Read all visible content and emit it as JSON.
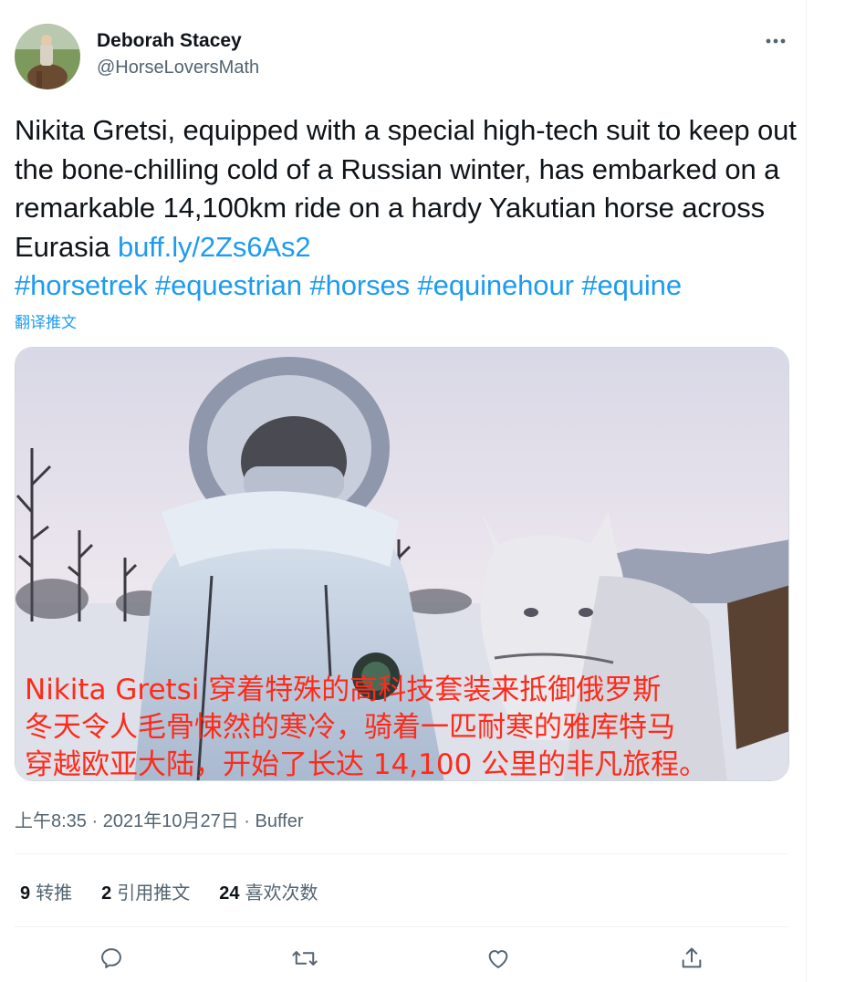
{
  "author": {
    "display_name": "Deborah Stacey",
    "handle": "@HorseLoversMath"
  },
  "tweet": {
    "text_main": "Nikita Gretsi, equipped with a special high-tech suit to keep out the bone-chilling cold of a Russian winter, has embarked on a remarkable 14,100km ride on a hardy Yakutian horse across Eurasia",
    "link": "buff.ly/2Zs6As2",
    "hashtags": [
      "#horsetrek",
      "#equestrian",
      "#horses",
      "#equinehour",
      "#equine"
    ],
    "translate_label": "翻译推文"
  },
  "media": {
    "caption_lines": [
      "Nikita Gretsi 穿着特殊的高科技套装来抵御俄罗斯",
      "冬天令人毛骨悚然的寒冷，骑着一匹耐寒的雅库特马",
      "穿越欧亚大陆，开始了长达 14,100 公里的非凡旅程。"
    ]
  },
  "meta": {
    "time": "上午8:35",
    "sep": "·",
    "date": "2021年10月27日",
    "source": "Buffer"
  },
  "stats": {
    "retweets_count": "9",
    "retweets_label": "转推",
    "quotes_count": "2",
    "quotes_label": "引用推文",
    "likes_count": "24",
    "likes_label": "喜欢次数"
  },
  "icons": {
    "more": "more-icon",
    "reply": "reply-icon",
    "retweet": "retweet-icon",
    "like": "like-icon",
    "share": "share-icon"
  },
  "colors": {
    "link": "#1d9bf0",
    "secondary_text": "#536471",
    "caption": "#ff2a1a"
  }
}
